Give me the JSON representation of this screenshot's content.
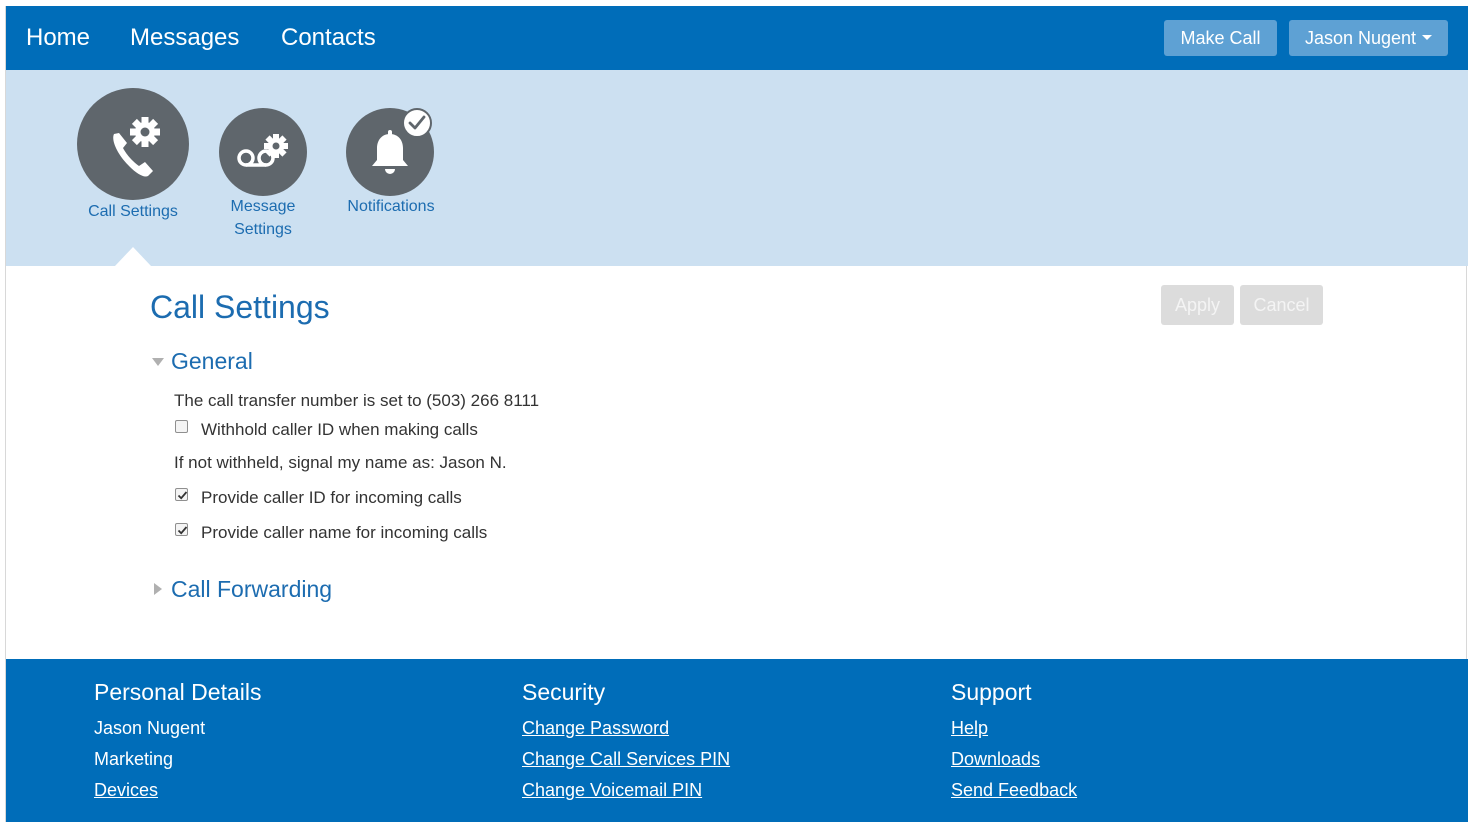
{
  "nav": {
    "links": [
      "Home",
      "Messages",
      "Contacts"
    ],
    "make_call": "Make Call",
    "user_menu": "Jason Nugent"
  },
  "categories": [
    {
      "label": "Call Settings",
      "icon": "phone-gear-icon",
      "active": true
    },
    {
      "label_line1": "Message",
      "label_line2": "Settings",
      "icon": "voicemail-gear-icon",
      "active": false
    },
    {
      "label": "Notifications",
      "icon": "bell-icon",
      "badge_icon": "checkmark-icon",
      "active": false
    }
  ],
  "content": {
    "title": "Call Settings",
    "apply": "Apply",
    "cancel": "Cancel",
    "general": {
      "heading": "General",
      "transfer_text": "The call transfer number is set to (503) 266 8111",
      "withhold": {
        "label": "Withhold caller ID when making calls",
        "checked": false
      },
      "signal_text": "If not withheld, signal my name as: Jason N.",
      "provide_id": {
        "label": "Provide caller ID for incoming calls",
        "checked": true
      },
      "provide_name": {
        "label": "Provide caller name for incoming calls",
        "checked": true
      }
    },
    "forwarding": {
      "heading": "Call Forwarding"
    }
  },
  "footer": {
    "personal": {
      "heading": "Personal Details",
      "items": [
        "Jason Nugent",
        "Marketing",
        "Devices"
      ]
    },
    "security": {
      "heading": "Security",
      "items": [
        "Change Password",
        "Change Call Services PIN",
        "Change Voicemail PIN"
      ]
    },
    "support": {
      "heading": "Support",
      "items": [
        "Help",
        "Downloads",
        "Send Feedback"
      ]
    }
  },
  "colors": {
    "brand": "#006db9",
    "band": "#cce0f1",
    "accent_text": "#1c6cb0",
    "icon_circle": "#5f666c"
  }
}
